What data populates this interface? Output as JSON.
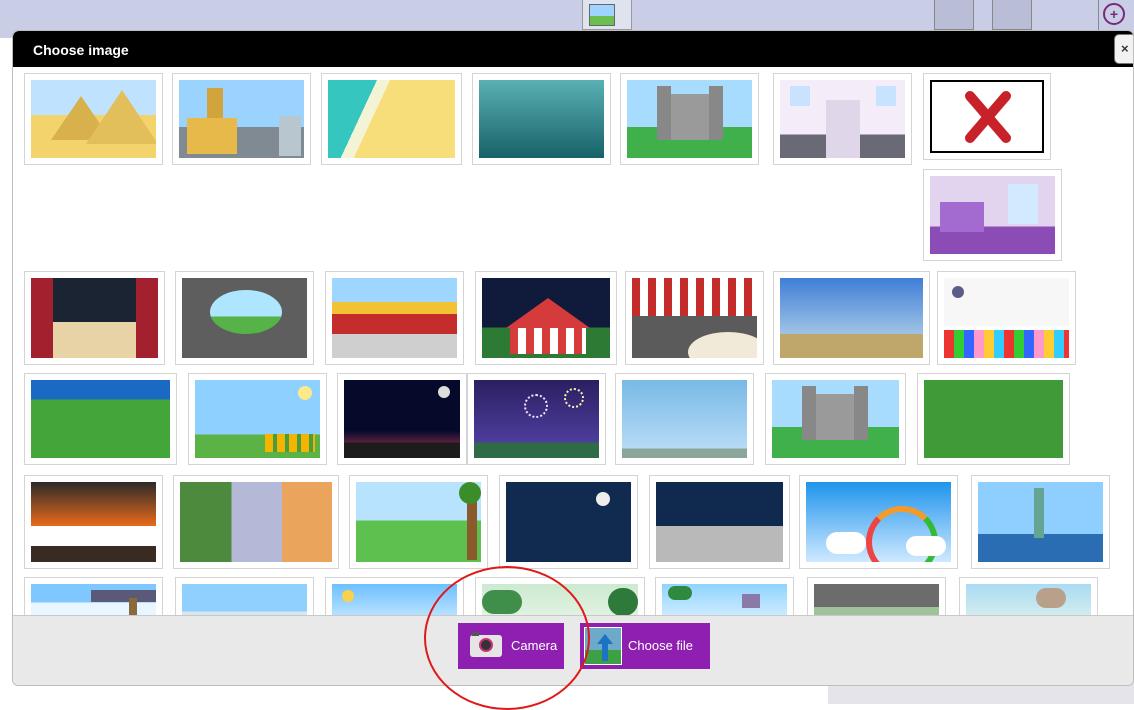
{
  "dialog": {
    "title": "Choose image",
    "close_label": "×"
  },
  "footer": {
    "camera_label": "Camera",
    "choose_file_label": "Choose file"
  },
  "thumbnails": {
    "rows": [
      [
        "pyramids",
        "london-big-ben",
        "beach",
        "underwater",
        "castle-green",
        "palace-stairs",
        "no-background"
      ],
      [
        "princess-bedroom"
      ],
      [
        "theater-stage",
        "cave",
        "chinese-palace",
        "circus-night",
        "circus-ring",
        "plain-desert",
        "disco-floor"
      ],
      [
        "green-field",
        "flower-meadow",
        "night-city",
        "fireworks",
        "blue-sky",
        "castle-green-2",
        "green-grass"
      ],
      [
        "burning-city",
        "forest-mountain-desert",
        "park-tree",
        "night-moon-stars",
        "moon-surface",
        "rainbow-sky",
        "statue-of-liberty"
      ],
      [
        "street-signpost",
        "paris-eiffel",
        "beach-sun",
        "park-bushes",
        "palm-beach",
        "city-street",
        "canyon-rocks"
      ]
    ]
  }
}
